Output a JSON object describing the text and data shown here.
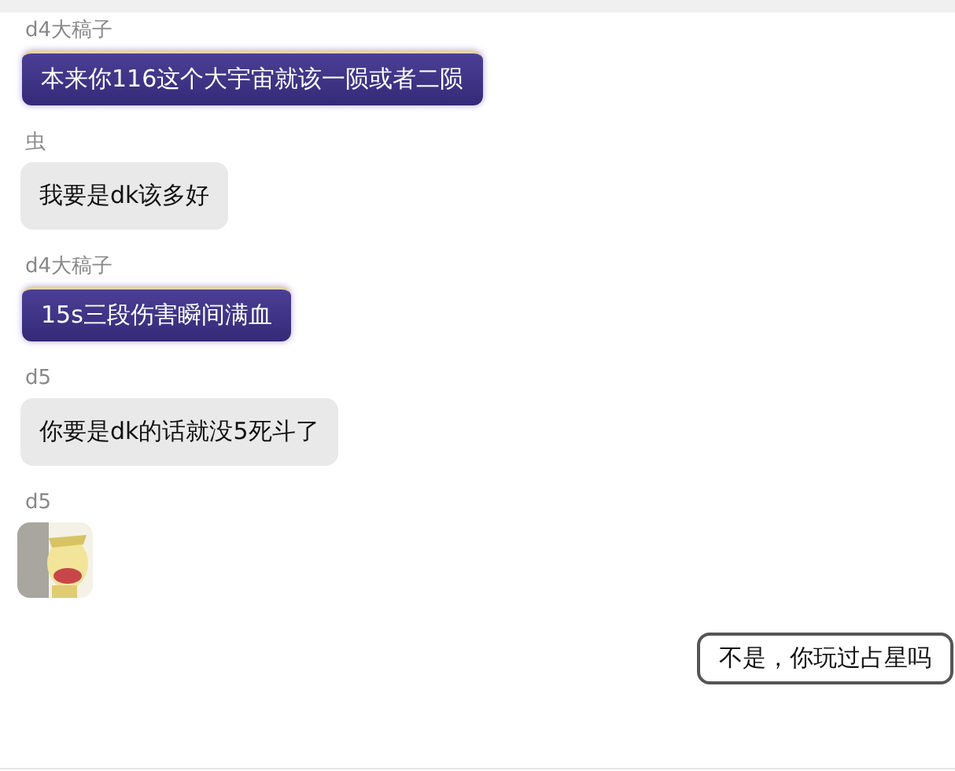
{
  "messages": [
    {
      "sender": "d4大稿子",
      "kind": "fancy",
      "text": "本来你116这个大宇宙就该一陨或者二陨"
    },
    {
      "sender": "虫",
      "kind": "plain",
      "text": "我要是dk该多好"
    },
    {
      "sender": "d4大稿子",
      "kind": "fancy",
      "text": "15s三段伤害瞬间满血"
    },
    {
      "sender": "d5",
      "kind": "plain",
      "text": "你要是dk的话就没5死斗了"
    },
    {
      "sender": "d5",
      "kind": "picture"
    },
    {
      "kind": "outlined",
      "text": "不是，你玩过占星吗"
    }
  ]
}
